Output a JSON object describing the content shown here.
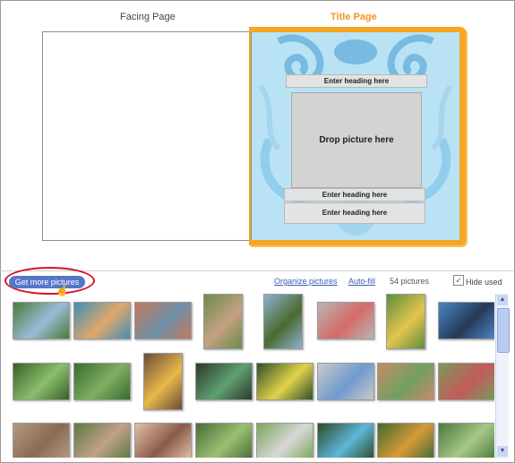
{
  "pages": {
    "facing_label": "Facing Page",
    "title_label": "Title Page"
  },
  "title_page": {
    "heading_top": "Enter heading here",
    "drop_picture": "Drop picture here",
    "heading_mid": "Enter heading here",
    "heading_bottom": "Enter heading here"
  },
  "toolbar": {
    "get_more_label": "Get more pictures",
    "organize_label": "Organize pictures",
    "autofill_label": "Auto-fill",
    "pic_count": "54 pictures",
    "hide_used_label": "Hide used",
    "hide_used_checked": true
  },
  "colors": {
    "accent": "#f5a623",
    "page_bg": "#b9e2f4",
    "button": "#5677c9",
    "highlight_ring": "#d9141e"
  },
  "thumbnails": [
    {
      "c1": "#4c7a3a",
      "c2": "#9bbcd8"
    },
    {
      "c1": "#3f8fb6",
      "c2": "#e0a86b"
    },
    {
      "c1": "#c47a5a",
      "c2": "#6e8fa9"
    },
    {
      "c1": "#6c8b4a",
      "c2": "#c4a182"
    },
    {
      "c1": "#8cb3d0",
      "c2": "#4b6a2f"
    },
    {
      "c1": "#b8b6b2",
      "c2": "#d46a6a"
    },
    {
      "c1": "#5f8e3b",
      "c2": "#e2c44f"
    },
    {
      "c1": "#4b85c5",
      "c2": "#263a56"
    },
    {
      "c1": "#3b5e2a",
      "c2": "#8bbf6c"
    },
    {
      "c1": "#3a6b2e",
      "c2": "#7fae62"
    },
    {
      "c1": "#6a4b3a",
      "c2": "#e8b94a"
    },
    {
      "c1": "#2c3a2a",
      "c2": "#5fa070"
    },
    {
      "c1": "#2f4f2a",
      "c2": "#e2d24a"
    },
    {
      "c1": "#c9c9c9",
      "c2": "#6f9bcf"
    },
    {
      "c1": "#c88a6a",
      "c2": "#6fa060"
    },
    {
      "c1": "#7a9a5a",
      "c2": "#c25a5a"
    },
    {
      "c1": "#b49a82",
      "c2": "#8a6a52"
    },
    {
      "c1": "#5b7a3f",
      "c2": "#c2a08a"
    },
    {
      "c1": "#e0c2a8",
      "c2": "#8b5a4a"
    },
    {
      "c1": "#4a6a3a",
      "c2": "#9bc070"
    },
    {
      "c1": "#7aa55a",
      "c2": "#d8d8d8"
    },
    {
      "c1": "#2e4a2a",
      "c2": "#5db7d8"
    },
    {
      "c1": "#3f6a2f",
      "c2": "#d89a3a"
    },
    {
      "c1": "#4a7a3a",
      "c2": "#a7c88a"
    }
  ]
}
